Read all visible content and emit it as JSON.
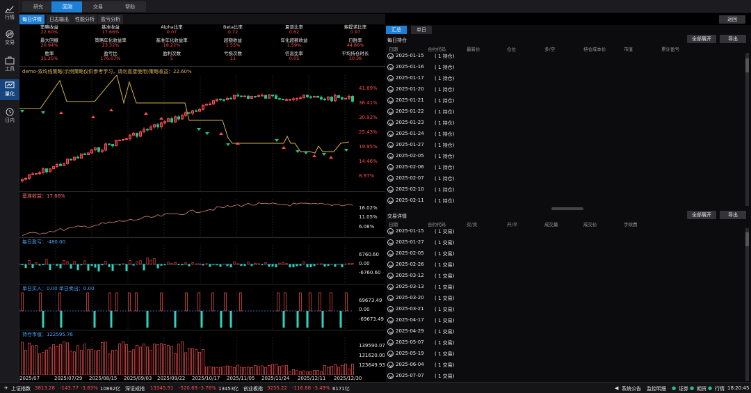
{
  "leftnav": [
    {
      "label": "行情",
      "icon": "chart-line-icon"
    },
    {
      "label": "交易",
      "icon": "exchange-icon"
    },
    {
      "label": "工具",
      "icon": "toolbox-icon"
    },
    {
      "label": "量化",
      "icon": "monitor-icon",
      "active": true
    },
    {
      "label": "日内",
      "icon": "clock-icon"
    }
  ],
  "toptabs": [
    "研究",
    "回测",
    "交易",
    "帮助"
  ],
  "toptab_active": 1,
  "subtabs": [
    "每日详情",
    "日志输出",
    "性能分析",
    "盈亏分析"
  ],
  "back_button": "返回",
  "stats": [
    {
      "k": "策略收益",
      "v": "22.60%"
    },
    {
      "k": "基准收益",
      "v": "17.66%"
    },
    {
      "k": "Alpha比率",
      "v": "0.07"
    },
    {
      "k": "Beta比率",
      "v": "0.72"
    },
    {
      "k": "夏普比率",
      "v": "0.62"
    },
    {
      "k": "索提诺比率",
      "v": "0.97"
    },
    {
      "k": "最大回撤",
      "v": "20.94%"
    },
    {
      "k": "策略年化收益率",
      "v": "23.32%"
    },
    {
      "k": "基准年化收益率",
      "v": "18.22%"
    },
    {
      "k": "超额收益",
      "v": "1.55%"
    },
    {
      "k": "年化超额收益",
      "v": "1.59%"
    },
    {
      "k": "日胜率",
      "v": "44.86%"
    },
    {
      "k": "胜率",
      "v": "31.25%"
    },
    {
      "k": "盈亏比",
      "v": "176.07%"
    },
    {
      "k": "盈利次数",
      "v": "5"
    },
    {
      "k": "亏损次数",
      "v": "11"
    },
    {
      "k": "信息比率",
      "v": "0.05"
    },
    {
      "k": "平均持仓时长",
      "v": "10.38"
    }
  ],
  "panels": {
    "main": {
      "title": "demo-双均线策略(示例策略仅供参考学习，请勿直接使用)策略收益：22.60%",
      "labels": [
        "41.89%",
        "36.41%",
        "30.92%",
        "25.43%",
        "19.95%",
        "14.46%",
        "8.97%"
      ]
    },
    "bench": {
      "title": "基准收益：17.66%",
      "labels": [
        "16.02%",
        "11.05%",
        "6.08%"
      ]
    },
    "daily": {
      "title": "每日盈亏：-480.00",
      "labels": [
        "6760.60",
        "0.00",
        "-6760.60"
      ]
    },
    "trade": {
      "title": "单日买入：0.00  单日卖出：0.00",
      "labels": [
        "69673.49",
        "0.00",
        "-69673.49"
      ]
    },
    "pos": {
      "title": "持仓市值：122595.76",
      "labels": [
        "139590.07",
        "131620.00",
        "123649.93"
      ]
    }
  },
  "xaxis": [
    "2025/07",
    "2025/07/29",
    "2025/08/15",
    "2025/09/03",
    "2025/09/22",
    "2025/10/17",
    "2025/11/05",
    "2025/11/24",
    "2025/12/11",
    "2025/12/30"
  ],
  "right": {
    "tabs": [
      "汇总",
      "单日"
    ],
    "hold": {
      "title": "每日持仓",
      "expand": "全部展开",
      "export": "导出",
      "headers": [
        "日期",
        "合约代码",
        "最新价",
        "仓位",
        "多/空",
        "持仓成本价",
        "市值",
        "累计盈亏"
      ],
      "rows": [
        [
          "2025-01-15",
          "( 1 持仓)"
        ],
        [
          "2025-01-16",
          "( 1 持仓)"
        ],
        [
          "2025-01-17",
          "( 1 持仓)"
        ],
        [
          "2025-01-20",
          "( 1 持仓)"
        ],
        [
          "2025-01-21",
          "( 1 持仓)"
        ],
        [
          "2025-01-22",
          "( 1 持仓)"
        ],
        [
          "2025-01-23",
          "( 1 持仓)"
        ],
        [
          "2025-01-24",
          "( 1 持仓)"
        ],
        [
          "2025-01-27",
          "( 1 持仓)"
        ],
        [
          "2025-02-05",
          "( 1 持仓)"
        ],
        [
          "2025-02-06",
          "( 1 持仓)"
        ],
        [
          "2025-02-07",
          "( 1 持仓)"
        ],
        [
          "2025-02-10",
          "( 1 持仓)"
        ],
        [
          "2025-02-11",
          "( 1 持仓)"
        ]
      ]
    },
    "trades": {
      "title": "交易详情",
      "expand": "全部展开",
      "export": "导出",
      "headers": [
        "日期",
        "合约代码",
        "买/卖",
        "开/平",
        "成交量",
        "成交价",
        "手续费"
      ],
      "rows": [
        [
          "2025-01-15",
          "( 1 交易)"
        ],
        [
          "2025-01-27",
          "( 1 交易)"
        ],
        [
          "2025-02-05",
          "( 1 交易)"
        ],
        [
          "2025-02-26",
          "( 1 交易)"
        ],
        [
          "2025-03-12",
          "( 1 交易)"
        ],
        [
          "2025-03-13",
          "( 1 交易)"
        ],
        [
          "2025-03-20",
          "( 1 交易)"
        ],
        [
          "2025-03-21",
          "( 1 交易)"
        ],
        [
          "2025-04-17",
          "( 1 交易)"
        ],
        [
          "2025-04-29",
          "( 1 交易)"
        ],
        [
          "2025-05-07",
          "( 1 交易)"
        ],
        [
          "2025-05-19",
          "( 1 交易)"
        ],
        [
          "2025-06-04",
          "( 1 交易)"
        ],
        [
          "2025-07-07",
          "( 1 交易)"
        ]
      ]
    }
  },
  "statusbar": {
    "indices": [
      {
        "name": "上证指数",
        "price": "3813.28",
        "chg": "-143.77",
        "pct": "-3.63%",
        "vol": "10862亿"
      },
      {
        "name": "深证成指",
        "price": "13345.51",
        "chg": "-520.69",
        "pct": "-3.76%",
        "vol": "13453亿"
      },
      {
        "name": "创业板指",
        "price": "3235.22",
        "chg": "-116.88",
        "pct": "-3.49%",
        "vol": "6171亿"
      }
    ],
    "notice": "系统公告",
    "monitor": "监控明细",
    "legend": [
      "证券",
      "期货",
      "行情"
    ],
    "time": "18:20:45"
  },
  "colors": {
    "up": "#ff4d4d",
    "down": "#25c28a",
    "accent": "#1e7fd6",
    "strategy_line": "#d4b44a",
    "bench_line": "#d98a7a"
  }
}
